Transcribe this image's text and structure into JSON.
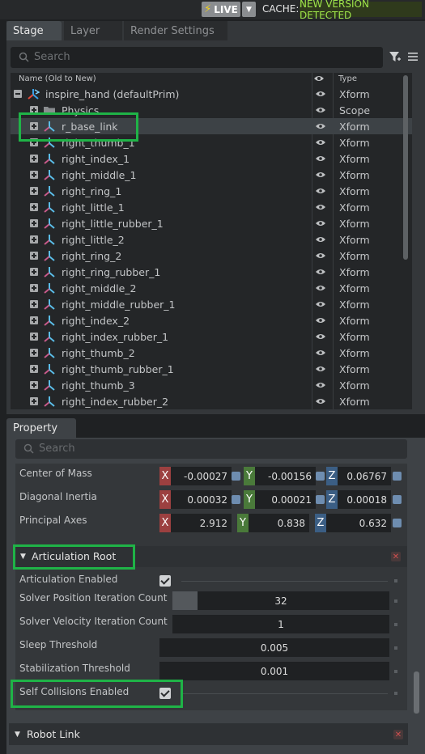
{
  "topbar": {
    "live_label": "LIVE",
    "cache_label": "CACHE:",
    "cache_status": "NEW VERSION DETECTED",
    "colors": {
      "live_bolt": "#f2d21b",
      "cache_status": "#9fe64a"
    }
  },
  "stage": {
    "tabs": [
      "Stage",
      "Layer",
      "Render Settings"
    ],
    "search_placeholder": "Search",
    "columns": {
      "name": "Name (Old to New)",
      "type": "Type"
    },
    "rows": [
      {
        "name": "inspire_hand (defaultPrim)",
        "type": "Xform",
        "icon": "xform-root-icon",
        "expander": "minus"
      },
      {
        "name": "Physics",
        "type": "Scope",
        "icon": "folder-icon",
        "expander": "plus"
      },
      {
        "name": "r_base_link",
        "type": "Xform",
        "icon": "xform-icon",
        "expander": "plus",
        "selected": true
      },
      {
        "name": "right_thumb_1",
        "type": "Xform",
        "icon": "xform-icon",
        "expander": "plus"
      },
      {
        "name": "right_index_1",
        "type": "Xform",
        "icon": "xform-icon",
        "expander": "plus"
      },
      {
        "name": "right_middle_1",
        "type": "Xform",
        "icon": "xform-icon",
        "expander": "plus"
      },
      {
        "name": "right_ring_1",
        "type": "Xform",
        "icon": "xform-icon",
        "expander": "plus"
      },
      {
        "name": "right_little_1",
        "type": "Xform",
        "icon": "xform-icon",
        "expander": "plus"
      },
      {
        "name": "right_little_rubber_1",
        "type": "Xform",
        "icon": "xform-icon",
        "expander": "plus"
      },
      {
        "name": "right_little_2",
        "type": "Xform",
        "icon": "xform-icon",
        "expander": "plus"
      },
      {
        "name": "right_ring_2",
        "type": "Xform",
        "icon": "xform-icon",
        "expander": "plus"
      },
      {
        "name": "right_ring_rubber_1",
        "type": "Xform",
        "icon": "xform-icon",
        "expander": "plus"
      },
      {
        "name": "right_middle_2",
        "type": "Xform",
        "icon": "xform-icon",
        "expander": "plus"
      },
      {
        "name": "right_middle_rubber_1",
        "type": "Xform",
        "icon": "xform-icon",
        "expander": "plus"
      },
      {
        "name": "right_index_2",
        "type": "Xform",
        "icon": "xform-icon",
        "expander": "plus"
      },
      {
        "name": "right_index_rubber_1",
        "type": "Xform",
        "icon": "xform-icon",
        "expander": "plus"
      },
      {
        "name": "right_thumb_2",
        "type": "Xform",
        "icon": "xform-icon",
        "expander": "plus"
      },
      {
        "name": "right_thumb_rubber_1",
        "type": "Xform",
        "icon": "xform-icon",
        "expander": "plus"
      },
      {
        "name": "right_thumb_3",
        "type": "Xform",
        "icon": "xform-icon",
        "expander": "plus"
      },
      {
        "name": "right_index_rubber_2",
        "type": "Xform",
        "icon": "xform-icon",
        "expander": "plus"
      }
    ]
  },
  "property": {
    "tab": "Property",
    "search_placeholder": "Search",
    "mass": {
      "center_of_mass": {
        "label": "Center of Mass",
        "x": "-0.00027",
        "y": "-0.00156",
        "z": "0.06767"
      },
      "diagonal_inertia": {
        "label": "Diagonal Inertia",
        "x": "0.00032",
        "y": "0.00021",
        "z": "0.00018"
      },
      "principal_axes": {
        "label": "Principal Axes",
        "x": "2.912",
        "y": "0.838",
        "z": "0.632"
      }
    },
    "articulation_root": {
      "title": "Articulation Root",
      "articulation_enabled": {
        "label": "Articulation Enabled",
        "checked": true
      },
      "solver_position": {
        "label": "Solver Position Iteration Count",
        "value": "32"
      },
      "solver_velocity": {
        "label": "Solver Velocity Iteration Count",
        "value": "1"
      },
      "sleep_threshold": {
        "label": "Sleep Threshold",
        "value": "0.005"
      },
      "stabilization_threshold": {
        "label": "Stabilization Threshold",
        "value": "0.001"
      },
      "self_collisions": {
        "label": "Self Collisions Enabled",
        "checked": true
      }
    },
    "robot_link": {
      "title": "Robot Link"
    }
  },
  "axis_labels": {
    "x": "X",
    "y": "Y",
    "z": "Z"
  }
}
